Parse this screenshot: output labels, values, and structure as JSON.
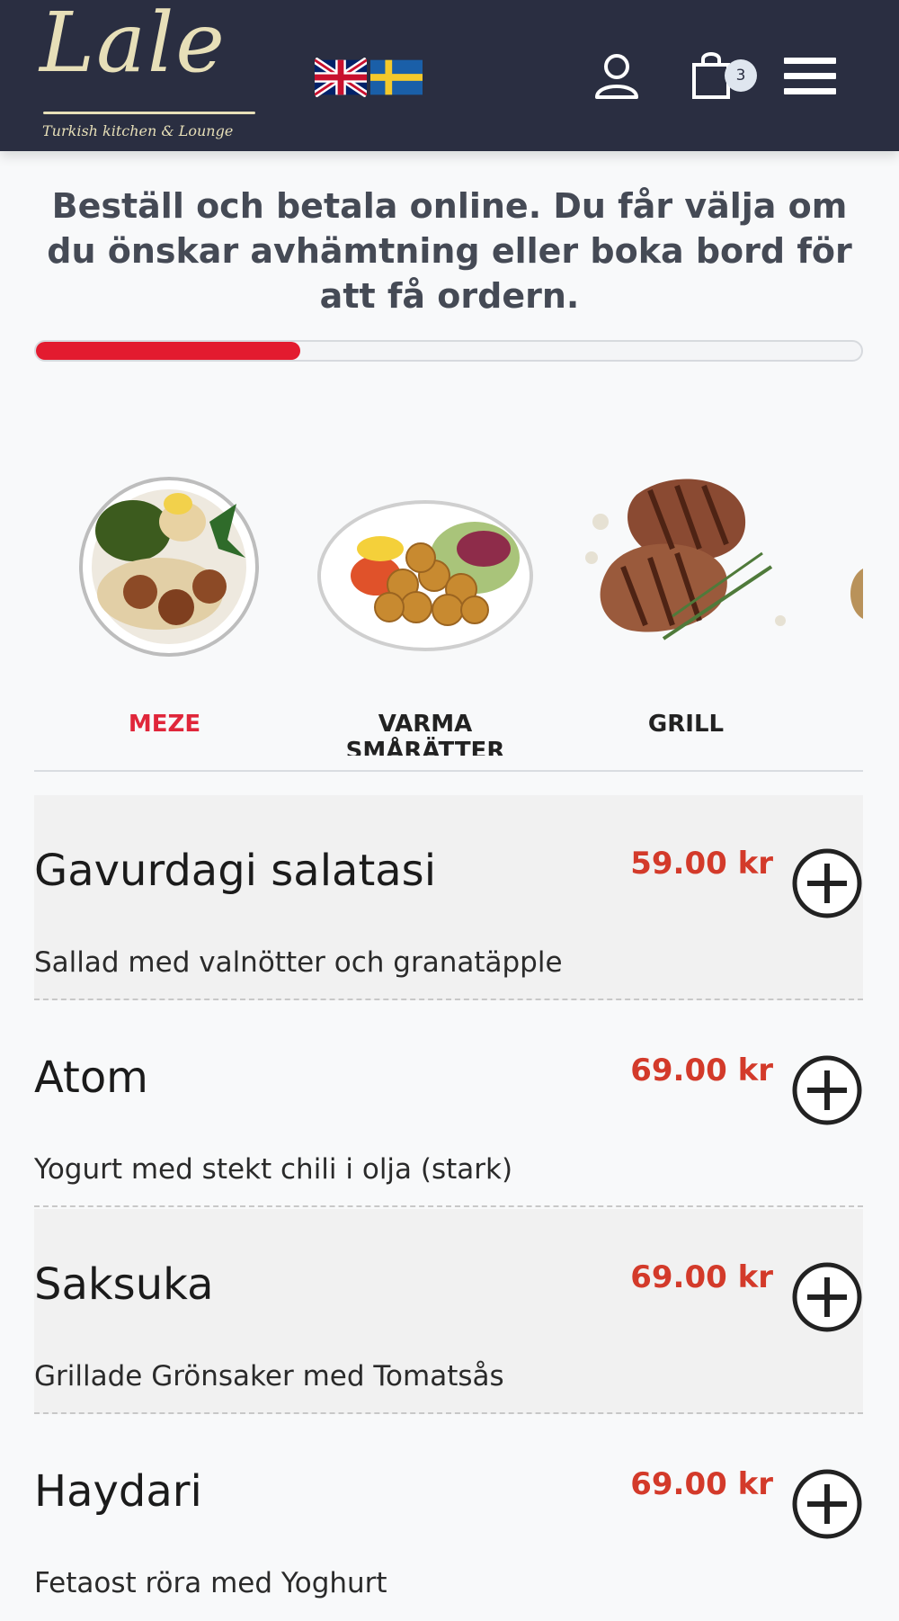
{
  "header": {
    "logo_text": "Lale",
    "logo_sub": "Turkish kitchen & Lounge",
    "cart_count": "3",
    "icons": [
      "user-icon",
      "cart-icon",
      "menu-icon",
      "flag-uk-icon",
      "flag-se-icon"
    ],
    "colors": {
      "bar": "#2a2e41",
      "logo": "#e7dfb8"
    }
  },
  "intro": {
    "text": "Beställ och betala online. Du får välja om du önskar avhämtning eller boka bord för att få ordern."
  },
  "progress": {
    "fraction": 0.32,
    "color": "#e31b2f"
  },
  "categories": [
    {
      "label": "MEZE",
      "active": true
    },
    {
      "label": "VARMA SMÅRÄTTER",
      "active": false
    },
    {
      "label": "GRILL",
      "active": false
    }
  ],
  "items": [
    {
      "name": "Gavurdagi salatasi",
      "desc": "Sallad med valnötter och granatäpple",
      "price": "59.00 kr"
    },
    {
      "name": "Atom",
      "desc": "Yogurt med stekt chili i olja (stark)",
      "price": "69.00 kr"
    },
    {
      "name": "Saksuka",
      "desc": "Grillade Grönsaker med Tomatsås",
      "price": "69.00 kr"
    },
    {
      "name": "Haydari",
      "desc": "Fetaost röra med Yoghurt",
      "price": "69.00 kr"
    }
  ]
}
